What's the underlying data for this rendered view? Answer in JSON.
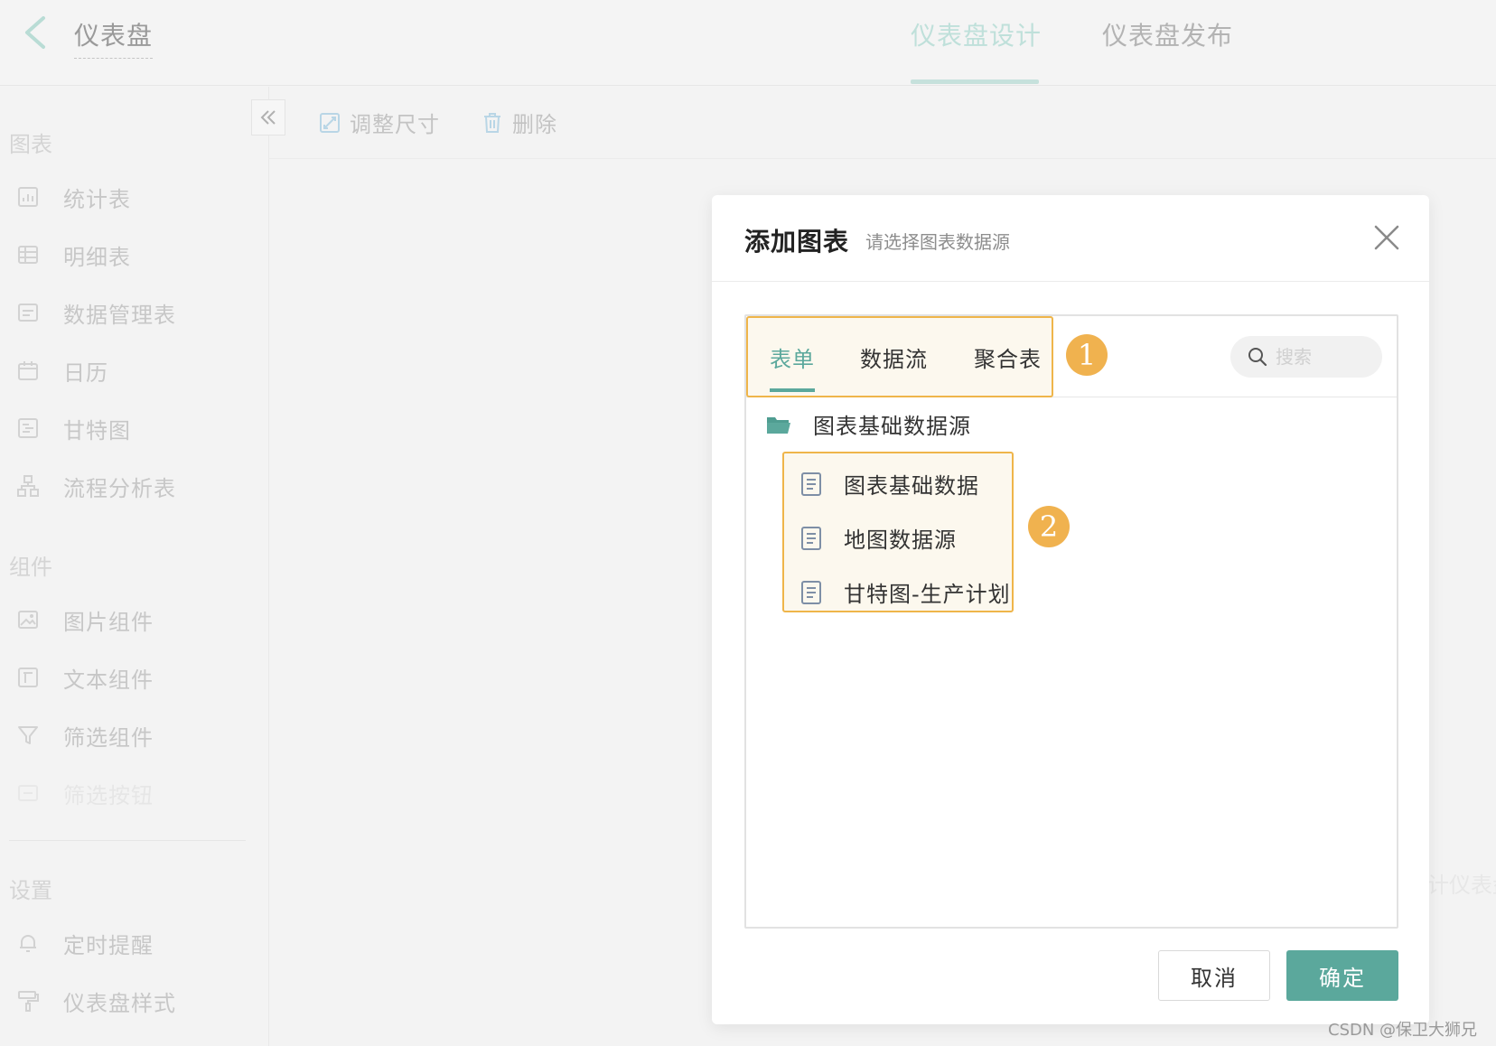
{
  "header": {
    "app_title": "仪表盘",
    "tabs": [
      {
        "label": "仪表盘设计",
        "active": true
      },
      {
        "label": "仪表盘发布",
        "active": false
      }
    ]
  },
  "sidebar": {
    "groups": [
      {
        "label": "图表",
        "items": [
          {
            "label": "统计表",
            "icon": "stat-table-icon"
          },
          {
            "label": "明细表",
            "icon": "detail-table-icon"
          },
          {
            "label": "数据管理表",
            "icon": "data-manage-icon"
          },
          {
            "label": "日历",
            "icon": "calendar-icon"
          },
          {
            "label": "甘特图",
            "icon": "gantt-icon"
          },
          {
            "label": "流程分析表",
            "icon": "flow-icon"
          }
        ]
      },
      {
        "label": "组件",
        "items": [
          {
            "label": "图片组件",
            "icon": "image-icon"
          },
          {
            "label": "文本组件",
            "icon": "text-icon"
          },
          {
            "label": "筛选组件",
            "icon": "filter-icon"
          },
          {
            "label": "筛选按钮",
            "icon": "filter-button-icon"
          }
        ]
      },
      {
        "label": "设置",
        "items": [
          {
            "label": "定时提醒",
            "icon": "bell-icon"
          },
          {
            "label": "仪表盘样式",
            "icon": "paint-roller-icon"
          }
        ]
      }
    ]
  },
  "toolbar": {
    "resize_label": "调整尺寸",
    "delete_label": "删除"
  },
  "canvas": {
    "hint_text": "计仪表盘"
  },
  "modal": {
    "title": "添加图表",
    "subtitle": "请选择图表数据源",
    "tabs": [
      {
        "label": "表单",
        "active": true
      },
      {
        "label": "数据流",
        "active": false
      },
      {
        "label": "聚合表",
        "active": false
      }
    ],
    "search_placeholder": "搜索",
    "folder": {
      "label": "图表基础数据源",
      "files": [
        {
          "label": "图表基础数据"
        },
        {
          "label": "地图数据源"
        },
        {
          "label": "甘特图-生产计划"
        }
      ]
    },
    "badges": {
      "tabs": "1",
      "files": "2"
    },
    "cancel_label": "取消",
    "ok_label": "确定"
  },
  "colors": {
    "accent": "#5ba89c",
    "highlight_border": "#efb54a",
    "highlight_fill": "#fcf8ee"
  },
  "watermark": "CSDN @保卫大狮兄"
}
